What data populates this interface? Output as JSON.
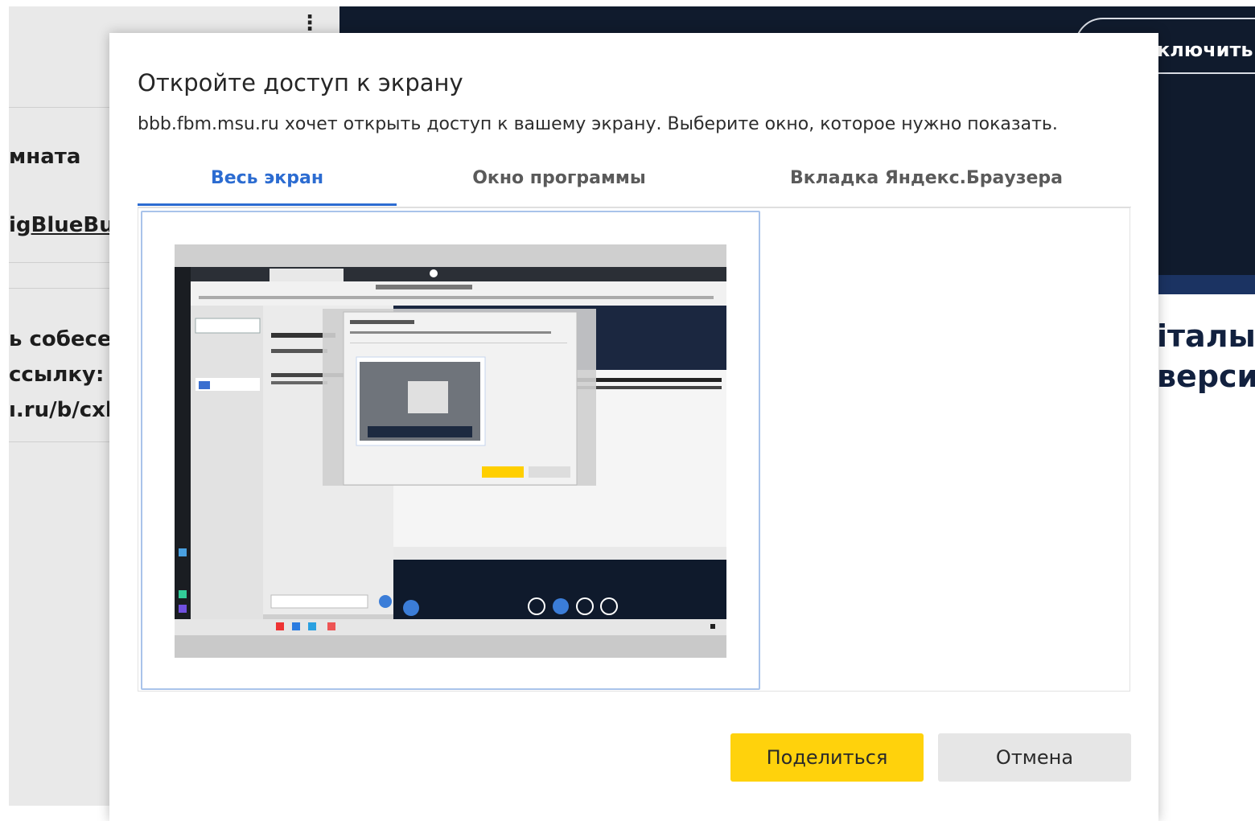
{
  "background": {
    "menu_glyph": "⋮",
    "room_title": "мната",
    "bbb_prefix": "ig",
    "bbb_link": "BlueBut",
    "invite_lines": [
      "ь собесе,",
      "ссылку:",
      "ı.ru/b/cxh"
    ],
    "pill_text": "ключить з",
    "right_heading_lines": [
      "італы",
      "верси"
    ]
  },
  "dialog": {
    "title": "Откройте доступ к экрану",
    "description": "bbb.fbm.msu.ru хочет открыть доступ к вашему экрану. Выберите окно, которое нужно показать.",
    "tabs": [
      {
        "label": "Весь экран",
        "active": true
      },
      {
        "label": "Окно программы",
        "active": false
      },
      {
        "label": "Вкладка Яндекс.Браузера",
        "active": false
      }
    ],
    "share_label": "Поделиться",
    "cancel_label": "Отмена"
  },
  "colors": {
    "accent": "#2c6cd1",
    "share_button": "#ffd20c",
    "dark_header": "#101b2d"
  }
}
